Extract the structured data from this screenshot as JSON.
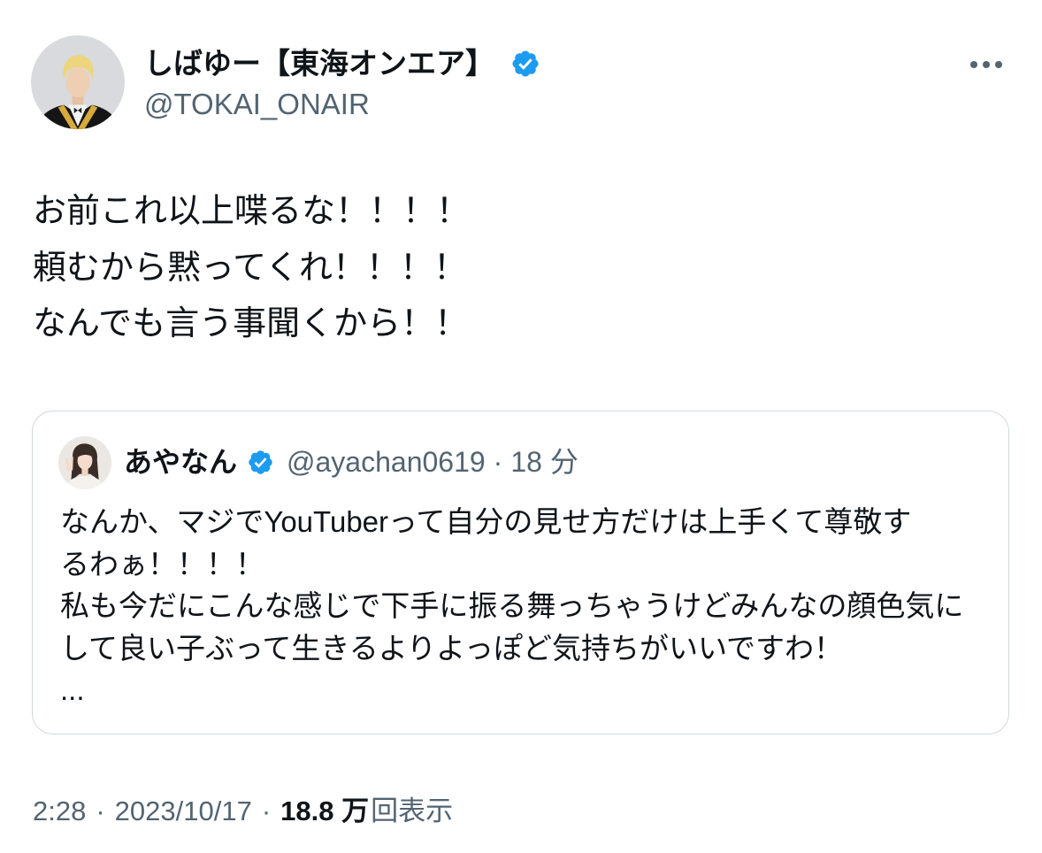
{
  "colors": {
    "background": "#ffffff",
    "text_primary": "#0f1419",
    "text_secondary": "#536471",
    "card_border": "#cfd9de",
    "verified_badge": "#1d9bf0"
  },
  "icons": {
    "verified": "verified-badge-icon",
    "more": "more-horizontal-icon"
  },
  "tweet": {
    "author": {
      "display_name": "しばゆー【東海オンエア】",
      "handle": "@TOKAI_ONAIR",
      "verified": true
    },
    "text_lines": [
      "お前これ以上喋るな！！！！",
      "頼むから黙ってくれ！！！！",
      "なんでも言う事聞くから！！"
    ],
    "quoted_tweet": {
      "author": {
        "display_name": "あやなん",
        "handle": "@ayachan0619",
        "verified": true
      },
      "separator": "·",
      "time_ago": "18 分",
      "text_lines": [
        "なんか、マジでYouTuberって自分の見せ方だけは上手くて尊敬す",
        "るわぁ！！！！",
        "私も今だにこんな感じで下手に振る舞っちゃうけどみんなの顔色気に",
        "して良い子ぶって生きるよりよっぽど気持ちがいいですわ！",
        "..."
      ]
    },
    "meta": {
      "time": "2:28",
      "separator": "·",
      "date": "2023/10/17",
      "views_count": "18.8 万",
      "views_label": "回表示"
    }
  }
}
